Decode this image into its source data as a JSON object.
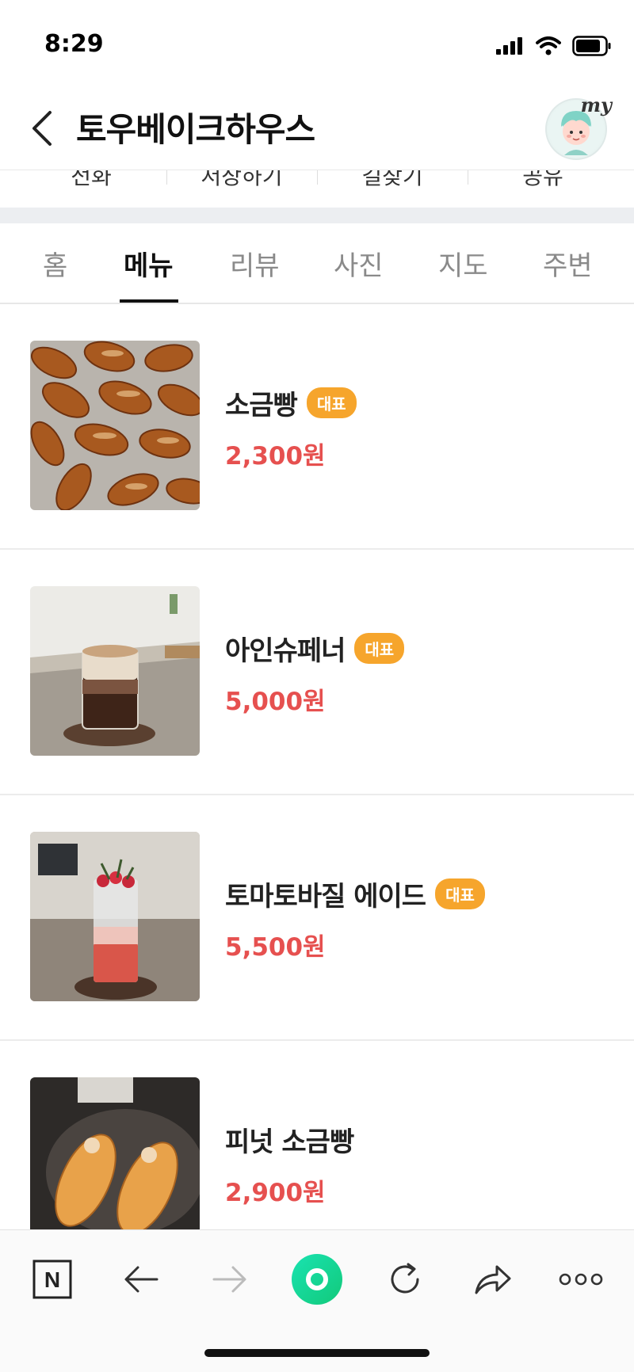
{
  "status_bar": {
    "time": "8:29"
  },
  "header": {
    "title": "토우베이크하우스",
    "avatar_label": "my"
  },
  "actions": [
    "전화",
    "저장하기",
    "길찾기",
    "공유"
  ],
  "tabs": [
    "홈",
    "메뉴",
    "리뷰",
    "사진",
    "지도",
    "주변"
  ],
  "active_tab": "메뉴",
  "menu": [
    {
      "name": "소금빵",
      "badge": "대표",
      "price": "2,300원"
    },
    {
      "name": "아인슈페너",
      "badge": "대표",
      "price": "5,000원"
    },
    {
      "name": "토마토바질 에이드",
      "badge": "대표",
      "price": "5,500원"
    },
    {
      "name": "피넛 소금빵",
      "badge": "",
      "price": "2,900원"
    }
  ],
  "toolbar": {
    "naver_label": "N",
    "icons": [
      "naver-home-icon",
      "back-arrow-icon",
      "forward-arrow-icon",
      "green-dot-icon",
      "refresh-icon",
      "share-icon",
      "more-icon"
    ]
  },
  "colors": {
    "badge": "#f6a52c",
    "price": "#e6504f",
    "green_button": "#1fd8a0"
  }
}
